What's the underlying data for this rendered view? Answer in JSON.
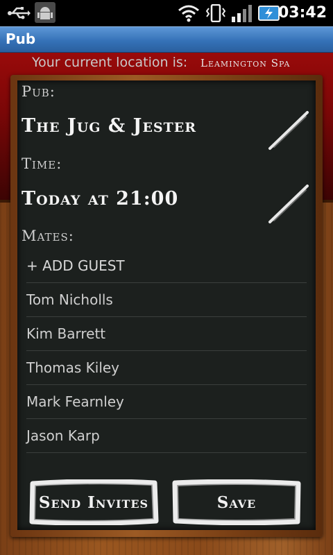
{
  "status_bar": {
    "time": "03:42",
    "icons": [
      "usb-icon",
      "android-debug-icon",
      "wifi-icon",
      "vibrate-icon",
      "signal-icon",
      "battery-charging-icon"
    ]
  },
  "app": {
    "title": "Pub"
  },
  "location": {
    "label": "Your current location is:",
    "value": "Leamington Spa"
  },
  "form": {
    "pub_label": "Pub:",
    "pub_value": "The Jug & Jester",
    "time_label": "Time:",
    "time_value": "Today at 21:00",
    "mates_label": "Mates:",
    "add_guest": "+ ADD GUEST",
    "mates": [
      "Tom Nicholls",
      "Kim Barrett",
      "Thomas Kiley",
      "Mark Fearnley",
      "Jason Karp"
    ]
  },
  "actions": {
    "send_invites": "Send Invites",
    "save": "Save"
  },
  "colors": {
    "title_bar": "#3572b8",
    "chalkboard": "#1c201e",
    "header_red": "#990a0a",
    "wood": "#9a5720"
  }
}
